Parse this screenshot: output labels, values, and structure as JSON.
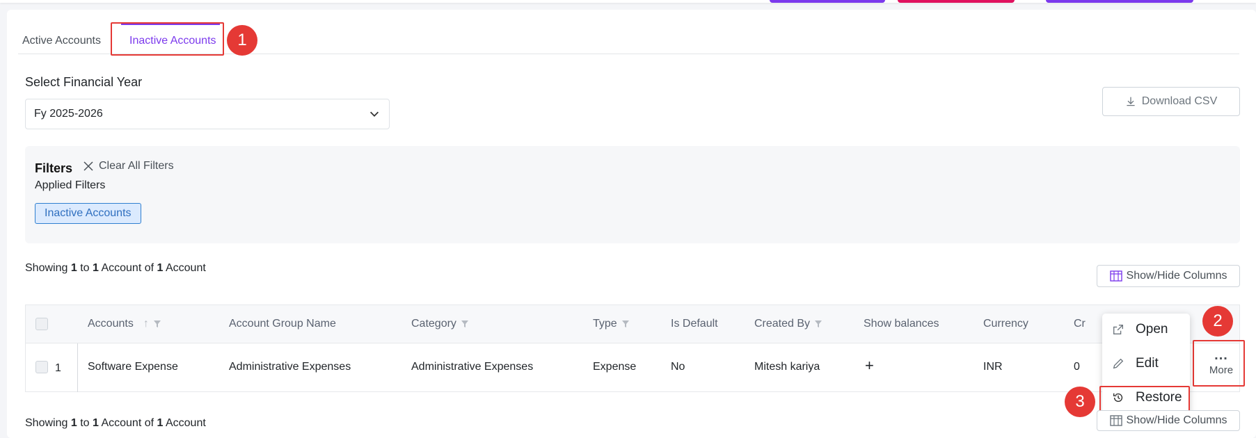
{
  "tabs": [
    {
      "label": "Active Accounts",
      "active": false
    },
    {
      "label": "Inactive Accounts",
      "active": true
    }
  ],
  "annotations": {
    "n1": "1",
    "n2": "2",
    "n3": "3"
  },
  "financial_year": {
    "label": "Select Financial Year",
    "value": "Fy 2025-2026"
  },
  "download_csv": "Download CSV",
  "filters": {
    "title": "Filters",
    "clear_all": "Clear All Filters",
    "applied_label": "Applied Filters",
    "chips": [
      "Inactive Accounts"
    ]
  },
  "summary": {
    "prefix": "Showing",
    "from": "1",
    "to_word": "to",
    "to": "1",
    "unit": "Account",
    "of_word": "of",
    "total": "1",
    "unit2": "Account"
  },
  "show_hide_columns": "Show/Hide Columns",
  "table": {
    "headers": {
      "accounts": "Accounts",
      "group": "Account Group Name",
      "category": "Category",
      "type": "Type",
      "is_default": "Is Default",
      "created_by": "Created By",
      "show_balances": "Show balances",
      "currency": "Currency",
      "cr": "Cr"
    },
    "rows": [
      {
        "index": "1",
        "account": "Software Expense",
        "group": "Administrative Expenses",
        "category": "Administrative Expenses",
        "type": "Expense",
        "is_default": "No",
        "created_by": "Mitesh kariya",
        "show_balances": "+",
        "currency": "INR",
        "cr": "0"
      }
    ]
  },
  "more": {
    "dots": "...",
    "label": "More"
  },
  "menu": {
    "open": "Open",
    "edit": "Edit",
    "restore": "Restore"
  },
  "colors": {
    "accent": "#7c3aed",
    "annotation": "#e53935",
    "chip_bg": "#dbeafe",
    "chip_border": "#2f7fd0"
  }
}
